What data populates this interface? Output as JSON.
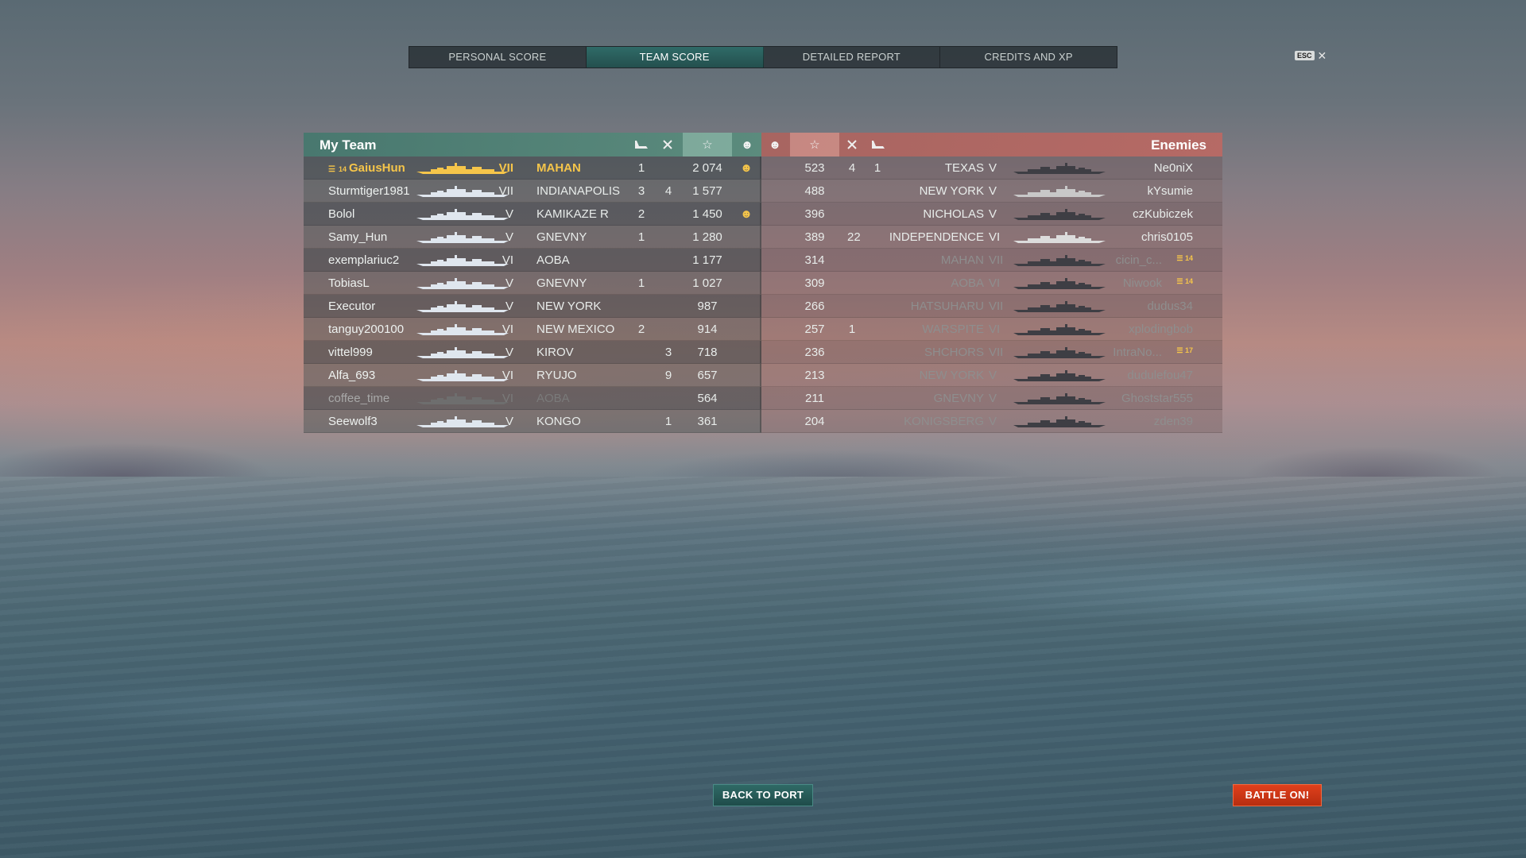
{
  "tabs": [
    {
      "label": "PERSONAL SCORE",
      "active": false
    },
    {
      "label": "TEAM SCORE",
      "active": true
    },
    {
      "label": "DETAILED REPORT",
      "active": false
    },
    {
      "label": "CREDITS AND XP",
      "active": false
    }
  ],
  "esc": {
    "key": "ESC",
    "close": "✕"
  },
  "my_team": {
    "title": "My Team",
    "rows": [
      {
        "player": "GaiusHun",
        "rank": "14",
        "tier": "VII",
        "ship": "MAHAN",
        "k1": "1",
        "k2": "",
        "score": "2 074",
        "cap": "☻"
      },
      {
        "player": "Sturmtiger1981",
        "rank": "",
        "tier": "VII",
        "ship": "INDIANAPOLIS",
        "k1": "3",
        "k2": "4",
        "score": "1 577",
        "cap": ""
      },
      {
        "player": "Bolol",
        "rank": "",
        "tier": "V",
        "ship": "KAMIKAZE R",
        "k1": "2",
        "k2": "",
        "score": "1 450",
        "cap": "☻"
      },
      {
        "player": "Samy_Hun",
        "rank": "",
        "tier": "V",
        "ship": "GNEVNY",
        "k1": "1",
        "k2": "",
        "score": "1 280",
        "cap": ""
      },
      {
        "player": "exemplariuc2",
        "rank": "",
        "tier": "VI",
        "ship": "AOBA",
        "k1": "",
        "k2": "",
        "score": "1 177",
        "cap": ""
      },
      {
        "player": "TobiasL",
        "rank": "",
        "tier": "V",
        "ship": "GNEVNY",
        "k1": "1",
        "k2": "",
        "score": "1 027",
        "cap": ""
      },
      {
        "player": "Executor",
        "rank": "",
        "tier": "V",
        "ship": "NEW YORK",
        "k1": "",
        "k2": "",
        "score": "987",
        "cap": ""
      },
      {
        "player": "tanguy200100",
        "rank": "",
        "tier": "VI",
        "ship": "NEW MEXICO",
        "k1": "2",
        "k2": "",
        "score": "914",
        "cap": ""
      },
      {
        "player": "vittel999",
        "rank": "",
        "tier": "V",
        "ship": "KIROV",
        "k1": "",
        "k2": "3",
        "score": "718",
        "cap": ""
      },
      {
        "player": "Alfa_693",
        "rank": "",
        "tier": "VI",
        "ship": "RYUJO",
        "k1": "",
        "k2": "9",
        "score": "657",
        "cap": ""
      },
      {
        "player": "coffee_time",
        "rank": "",
        "tier": "VI",
        "ship": "AOBA",
        "k1": "",
        "k2": "",
        "score": "564",
        "cap": ""
      },
      {
        "player": "Seewolf3",
        "rank": "",
        "tier": "V",
        "ship": "KONGO",
        "k1": "",
        "k2": "1",
        "score": "361",
        "cap": ""
      }
    ]
  },
  "enemies": {
    "title": "Enemies",
    "rows": [
      {
        "score": "523",
        "k2": "4",
        "k1": "1",
        "ship": "TEXAS",
        "tier": "V",
        "player": "Ne0niX",
        "rank": ""
      },
      {
        "score": "488",
        "k2": "",
        "k1": "",
        "ship": "NEW YORK",
        "tier": "V",
        "player": "kYsumie",
        "rank": ""
      },
      {
        "score": "396",
        "k2": "",
        "k1": "",
        "ship": "NICHOLAS",
        "tier": "V",
        "player": "czKubiczek",
        "rank": ""
      },
      {
        "score": "389",
        "k2": "22",
        "k1": "",
        "ship": "INDEPENDENCE",
        "tier": "VI",
        "player": "chris0105",
        "rank": ""
      },
      {
        "score": "314",
        "k2": "",
        "k1": "",
        "ship": "MAHAN",
        "tier": "VII",
        "player": "cicin_c...",
        "rank": "14"
      },
      {
        "score": "309",
        "k2": "",
        "k1": "",
        "ship": "AOBA",
        "tier": "VI",
        "player": "Niwook",
        "rank": "14"
      },
      {
        "score": "266",
        "k2": "",
        "k1": "",
        "ship": "HATSUHARU",
        "tier": "VII",
        "player": "dudus34",
        "rank": ""
      },
      {
        "score": "257",
        "k2": "1",
        "k1": "",
        "ship": "WARSPITE",
        "tier": "VI",
        "player": "xplodingbob",
        "rank": ""
      },
      {
        "score": "236",
        "k2": "",
        "k1": "",
        "ship": "SHCHORS",
        "tier": "VII",
        "player": "IntraNo...",
        "rank": "17"
      },
      {
        "score": "213",
        "k2": "",
        "k1": "",
        "ship": "NEW YORK",
        "tier": "V",
        "player": "dudulefou47",
        "rank": ""
      },
      {
        "score": "211",
        "k2": "",
        "k1": "",
        "ship": "GNEVNY",
        "tier": "V",
        "player": "Ghoststar555",
        "rank": ""
      },
      {
        "score": "204",
        "k2": "",
        "k1": "",
        "ship": "KONIGSBERG",
        "tier": "V",
        "player": "zden39",
        "rank": ""
      }
    ]
  },
  "buttons": {
    "back_to_port": "BACK TO PORT",
    "battle_on": "BATTLE ON!"
  },
  "colors": {
    "my_team_header": "#5a8c7d",
    "enemy_header": "#b46a64",
    "highlight": "#f5c54a",
    "battle_button": "#d33a18",
    "port_button": "#2a5d5a"
  }
}
